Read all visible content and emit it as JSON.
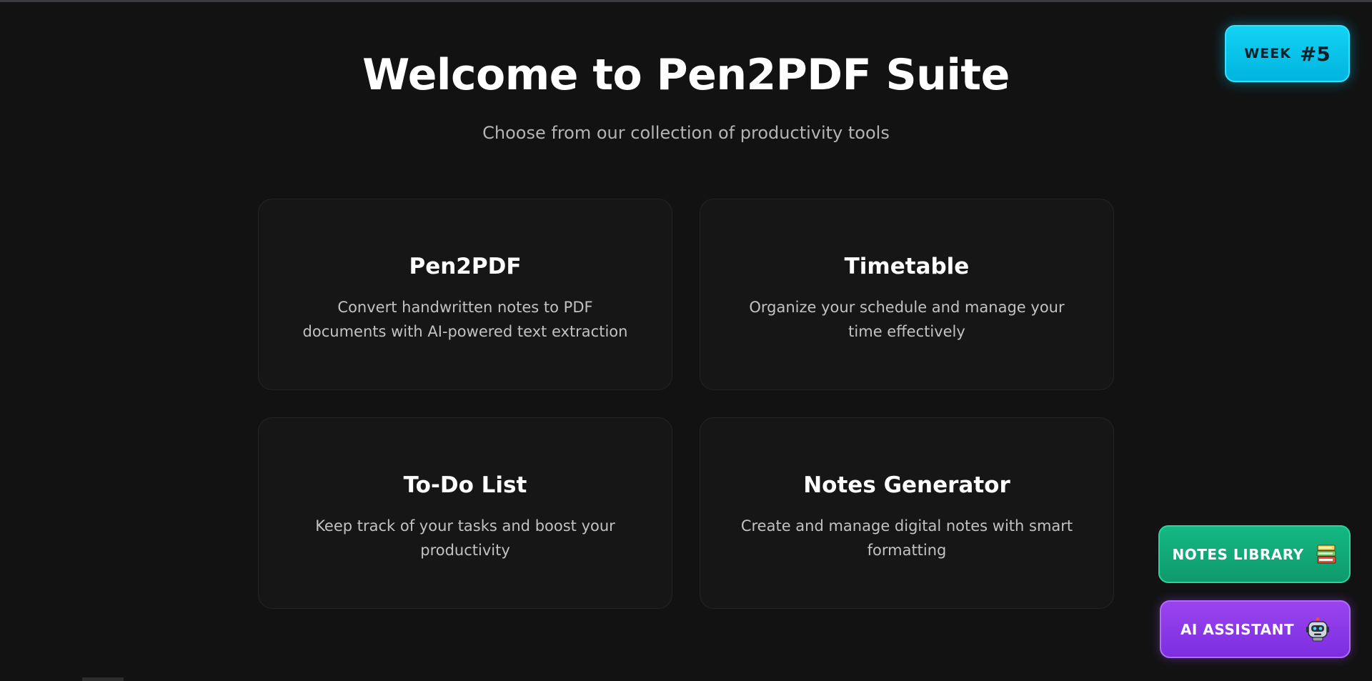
{
  "header": {
    "title": "Welcome to Pen2PDF Suite",
    "subtitle": "Choose from our collection of productivity tools"
  },
  "tools": [
    {
      "title": "Pen2PDF",
      "description": "Convert handwritten notes to PDF documents with AI-powered text extraction"
    },
    {
      "title": "Timetable",
      "description": "Organize your schedule and manage your time effectively"
    },
    {
      "title": "To-Do List",
      "description": "Keep track of your tasks and boost your productivity"
    },
    {
      "title": "Notes Generator",
      "description": "Create and manage digital notes with smart formatting"
    }
  ],
  "week_badge": {
    "label": "WEEK",
    "number": "#5"
  },
  "floating_buttons": {
    "notes_library": {
      "label": "NOTES LIBRARY",
      "icon": "books-icon"
    },
    "ai_assistant": {
      "label": "AI ASSISTANT",
      "icon": "robot-icon"
    }
  },
  "colors": {
    "background": "#121212",
    "card": "#161616",
    "week_badge": "#00c8ec",
    "notes_library": "#12a878",
    "ai_assistant": "#8a3be8"
  }
}
